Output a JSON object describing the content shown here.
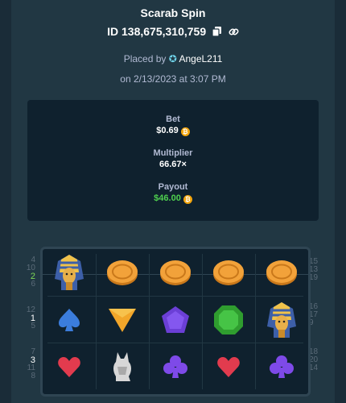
{
  "header": {
    "title": "Scarab Spin",
    "bet_id": "ID 138,675,310,759",
    "placed_by_prefix": "Placed by",
    "username": "AngeL211",
    "date": "on 2/13/2023 at 3:07 PM"
  },
  "summary": {
    "bet_label": "Bet",
    "bet_value": "$0.69",
    "multiplier_label": "Multiplier",
    "multiplier_value": "66.67×",
    "payout_label": "Payout",
    "payout_value": "$46.00",
    "currency_icon": "bitcoin-coin-icon"
  },
  "left_line_numbers": [
    {
      "top": "4",
      "mid": "10",
      "hl": "2",
      "bot": "6"
    },
    {
      "top": "12",
      "hl": "1",
      "bot": "5"
    },
    {
      "top": "7",
      "hl": "3",
      "bot1": "11",
      "bot2": "8"
    }
  ],
  "right_line_numbers": [
    [
      "15",
      "13",
      "19"
    ],
    [
      "16",
      "17",
      "9"
    ],
    [
      "18",
      "20",
      "14"
    ]
  ],
  "reels": [
    [
      "pharaoh",
      "coin",
      "coin",
      "coin",
      "coin"
    ],
    [
      "spade",
      "triangle",
      "pentagon",
      "gem-green",
      "pharaoh"
    ],
    [
      "heart",
      "cat",
      "club",
      "heart",
      "club"
    ]
  ],
  "colors": {
    "accent_green": "#4fd04f",
    "coin_orange": "#f3a50c",
    "background": "#213743",
    "panel": "#0f212e"
  }
}
